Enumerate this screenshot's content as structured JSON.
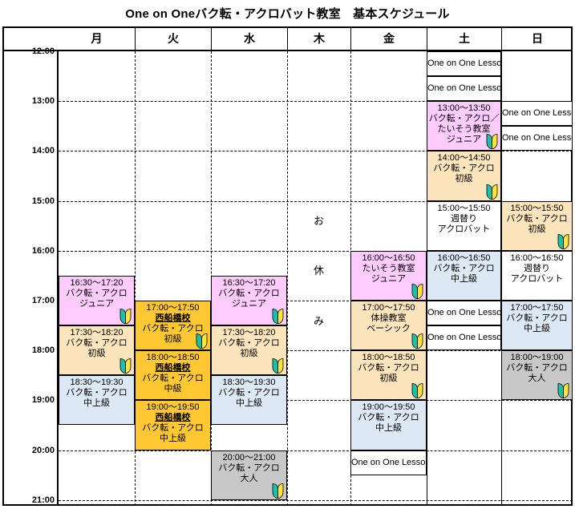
{
  "title": "One on Oneバク転・アクロバット教室　基本スケジュール",
  "columns": [
    {
      "key": "mon",
      "label": "月"
    },
    {
      "key": "tue",
      "label": "火"
    },
    {
      "key": "wed",
      "label": "水"
    },
    {
      "key": "thu",
      "label": "木"
    },
    {
      "key": "fri",
      "label": "金"
    },
    {
      "key": "sat",
      "label": "土"
    },
    {
      "key": "sun",
      "label": "日"
    }
  ],
  "time_labels": [
    "12:00",
    "13:00",
    "14:00",
    "15:00",
    "16:00",
    "17:00",
    "18:00",
    "19:00",
    "20:00",
    "21:00"
  ],
  "closed_note": {
    "day": "木",
    "chars": [
      "お",
      "休",
      "み"
    ]
  },
  "legend": {
    "leaf_icon": "beginner-leaf-icon"
  },
  "colors": {
    "pink": "#FFCCFF",
    "cream": "#FCE4BC",
    "blue": "#DCE9F5",
    "orange": "#FFC832",
    "gray": "#C8C8C8",
    "white": "#FFFFFF",
    "border": "#000000"
  },
  "events": [
    {
      "day": "sat",
      "time": "",
      "name": "One on One Lesson",
      "color": "white",
      "leaf": false,
      "start": 12.0,
      "end": 12.5,
      "kind": "oneonone"
    },
    {
      "day": "sat",
      "time": "",
      "name": "One on One Lesson",
      "color": "white",
      "leaf": false,
      "start": 12.5,
      "end": 13.0,
      "kind": "oneonone"
    },
    {
      "day": "sat",
      "time": "13:00〜13:50",
      "name": "バク転・アクロ／\nたいそう教室\nジュニア",
      "color": "pink",
      "leaf": true,
      "start": 13.0,
      "end": 14.0,
      "kind": "class"
    },
    {
      "day": "sat",
      "time": "14:00〜14:50",
      "name": "バク転・アクロ\n初級",
      "color": "cream",
      "leaf": true,
      "start": 14.0,
      "end": 15.0,
      "kind": "class"
    },
    {
      "day": "sat",
      "time": "15:00〜15:50",
      "name": "週替り\nアクロバット",
      "color": "white",
      "leaf": false,
      "start": 15.0,
      "end": 16.0,
      "kind": "class"
    },
    {
      "day": "sat",
      "time": "16:00〜16:50",
      "name": "バク転・アクロ\n中上級",
      "color": "blue",
      "leaf": false,
      "start": 16.0,
      "end": 17.0,
      "kind": "class"
    },
    {
      "day": "sat",
      "time": "",
      "name": "One on One Lesson",
      "color": "white",
      "leaf": false,
      "start": 17.0,
      "end": 17.5,
      "kind": "oneonone"
    },
    {
      "day": "sat",
      "time": "",
      "name": "One on One Lesson",
      "color": "white",
      "leaf": false,
      "start": 17.5,
      "end": 18.0,
      "kind": "oneonone"
    },
    {
      "day": "sun",
      "time": "",
      "name": "One on One Lesson",
      "color": "white",
      "leaf": false,
      "start": 13.0,
      "end": 13.5,
      "kind": "oneonone"
    },
    {
      "day": "sun",
      "time": "",
      "name": "One on One Lesson",
      "color": "white",
      "leaf": false,
      "start": 13.5,
      "end": 14.0,
      "kind": "oneonone"
    },
    {
      "day": "sun",
      "time": "15:00〜15:50",
      "name": "バク転・アクロ\n初級",
      "color": "cream",
      "leaf": true,
      "start": 15.0,
      "end": 16.0,
      "kind": "class"
    },
    {
      "day": "sun",
      "time": "16:00〜16:50",
      "name": "週替り\nアクロバット",
      "color": "white",
      "leaf": false,
      "start": 16.0,
      "end": 17.0,
      "kind": "class"
    },
    {
      "day": "sun",
      "time": "17:00〜17:50",
      "name": "バク転・アクロ\n中上級",
      "color": "blue",
      "leaf": false,
      "start": 17.0,
      "end": 18.0,
      "kind": "class"
    },
    {
      "day": "sun",
      "time": "18:00〜19:00",
      "name": "バク転・アクロ\n大人",
      "color": "gray",
      "leaf": true,
      "start": 18.0,
      "end": 19.0,
      "kind": "class"
    },
    {
      "day": "mon",
      "time": "16:30〜17:20",
      "name": "バク転・アクロ\nジュニア",
      "color": "pink",
      "leaf": true,
      "start": 16.5,
      "end": 17.5,
      "kind": "class"
    },
    {
      "day": "mon",
      "time": "17:30〜18:20",
      "name": "バク転・アクロ\n初級",
      "color": "cream",
      "leaf": true,
      "start": 17.5,
      "end": 18.5,
      "kind": "class"
    },
    {
      "day": "mon",
      "time": "18:30〜19:30",
      "name": "バク転・アクロ\n中上級",
      "color": "blue",
      "leaf": false,
      "start": 18.5,
      "end": 19.5,
      "kind": "class"
    },
    {
      "day": "tue",
      "time": "17:00〜17:50",
      "branch": "西船橋校",
      "name": "バク転・アクロ\n初級",
      "color": "orange",
      "leaf": true,
      "start": 17.0,
      "end": 18.0,
      "kind": "class"
    },
    {
      "day": "tue",
      "time": "18:00〜18:50",
      "branch": "西船橋校",
      "name": "バク転・アクロ\n中級",
      "color": "orange",
      "leaf": false,
      "start": 18.0,
      "end": 19.0,
      "kind": "class"
    },
    {
      "day": "tue",
      "time": "19:00〜19:50",
      "branch": "西船橋校",
      "name": "バク転・アクロ\n中上級",
      "color": "orange",
      "leaf": false,
      "start": 19.0,
      "end": 20.0,
      "kind": "class"
    },
    {
      "day": "wed",
      "time": "16:30〜17:20",
      "name": "バク転・アクロ\nジュニア",
      "color": "pink",
      "leaf": true,
      "start": 16.5,
      "end": 17.5,
      "kind": "class"
    },
    {
      "day": "wed",
      "time": "17:30〜18:20",
      "name": "バク転・アクロ\n初級",
      "color": "cream",
      "leaf": true,
      "start": 17.5,
      "end": 18.5,
      "kind": "class"
    },
    {
      "day": "wed",
      "time": "18:30〜19:30",
      "name": "バク転・アクロ\n中上級",
      "color": "blue",
      "leaf": false,
      "start": 18.5,
      "end": 19.5,
      "kind": "class"
    },
    {
      "day": "wed",
      "time": "20:00〜21:00",
      "name": "バク転・アクロ\n大人",
      "color": "gray",
      "leaf": true,
      "start": 20.0,
      "end": 21.0,
      "kind": "class"
    },
    {
      "day": "fri",
      "time": "16:00〜16:50",
      "name": "たいそう教室\nジュニア",
      "color": "pink",
      "leaf": true,
      "start": 16.0,
      "end": 17.0,
      "kind": "class"
    },
    {
      "day": "fri",
      "time": "17:00〜17:50",
      "name": "体操教室\nベーシック",
      "color": "cream",
      "leaf": true,
      "start": 17.0,
      "end": 18.0,
      "kind": "class"
    },
    {
      "day": "fri",
      "time": "18:00〜18:50",
      "name": "バク転・アクロ\n初級",
      "color": "cream",
      "leaf": true,
      "start": 18.0,
      "end": 19.0,
      "kind": "class"
    },
    {
      "day": "fri",
      "time": "19:00〜19:50",
      "name": "バク転・アクロ\n中上級",
      "color": "blue",
      "leaf": false,
      "start": 19.0,
      "end": 20.0,
      "kind": "class"
    },
    {
      "day": "fri",
      "time": "",
      "name": "One on One Lesson",
      "color": "white",
      "leaf": false,
      "start": 20.0,
      "end": 20.5,
      "kind": "oneonone"
    }
  ]
}
